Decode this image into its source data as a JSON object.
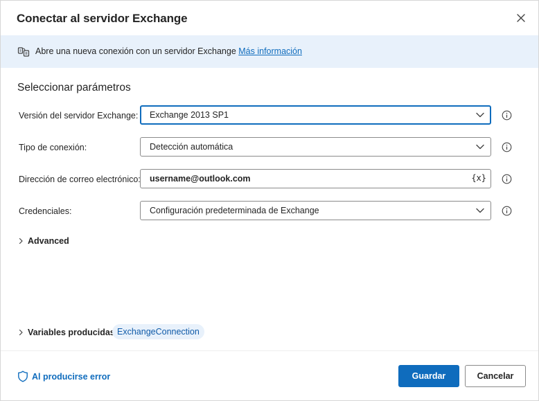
{
  "dialog": {
    "title": "Conectar al servidor Exchange",
    "close_icon": "close-icon"
  },
  "banner": {
    "text": "Abre una nueva conexión con un servidor Exchange ",
    "link": "Más información",
    "icon": "exchange-icon"
  },
  "section": {
    "title": "Seleccionar parámetros"
  },
  "fields": {
    "server_version": {
      "label": "Versión del servidor Exchange:",
      "value": "Exchange 2013 SP1"
    },
    "connection_type": {
      "label": "Tipo de conexión:",
      "value": "Detección automática"
    },
    "email": {
      "label": "Dirección de correo electrónico:",
      "value": "username@outlook.com",
      "var_icon": "{x}"
    },
    "credentials": {
      "label": "Credenciales:",
      "value": "Configuración predeterminada de Exchange"
    }
  },
  "advanced": {
    "label": "Advanced"
  },
  "variables": {
    "label": "Variables producidas",
    "pill": "ExchangeConnection"
  },
  "footer": {
    "on_error": "Al producirse error",
    "save": "Guardar",
    "cancel": "Cancelar"
  },
  "colors": {
    "accent": "#0f6cbd",
    "banner_bg": "#e8f1fb",
    "text": "#242424"
  }
}
